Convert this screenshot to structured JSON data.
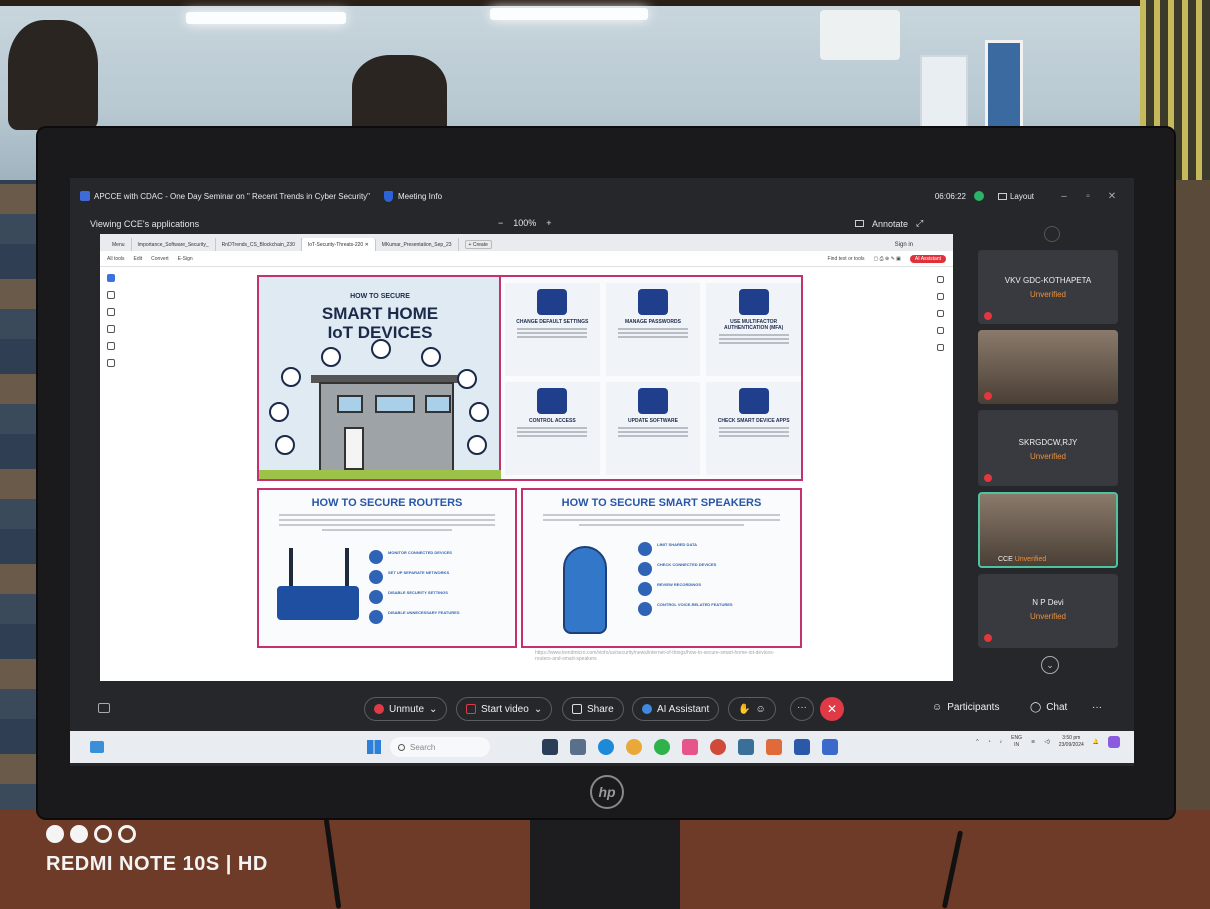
{
  "window": {
    "meeting_title": "APCCE with CDAC - One Day Seminar on \" Recent Trends in Cyber Security\"",
    "meeting_info": "Meeting Info",
    "timer": "06:06:22",
    "layout": "Layout"
  },
  "share_bar": {
    "viewing": "Viewing CCE's applications",
    "zoom_out": "−",
    "zoom": "100%",
    "zoom_in": "+",
    "annotate": "Annotate"
  },
  "browser": {
    "tabs": [
      {
        "label": "Menu"
      },
      {
        "label": "Importance_Software_Security_"
      },
      {
        "label": "RnDTrends_CS_Blockchain_230"
      },
      {
        "label": "IoT-Security-Threats-220"
      },
      {
        "label": "MKumar_Presentation_Sep_23"
      }
    ],
    "new_tab": "+ Create",
    "sign_in": "Sign in",
    "toolbar": {
      "all_tools": "All tools",
      "edit": "Edit",
      "convert": "Convert",
      "esign": "E-Sign",
      "find": "Find text or tools",
      "ai_assistant": "AI Assistant"
    }
  },
  "infographic": {
    "hero_subtitle": "HOW TO SECURE",
    "hero_title_1": "SMART HOME",
    "hero_title_2": "IoT DEVICES",
    "tips": [
      {
        "title": "CHANGE DEFAULT SETTINGS"
      },
      {
        "title": "MANAGE PASSWORDS"
      },
      {
        "title": "USE MULTIFACTOR AUTHENTICATION (MFA)"
      },
      {
        "title": "CONTROL ACCESS"
      },
      {
        "title": "UPDATE SOFTWARE"
      },
      {
        "title": "CHECK SMART DEVICE APPS"
      }
    ],
    "routers_title": "HOW TO SECURE ROUTERS",
    "router_items": [
      "MONITOR CONNECTED DEVICES",
      "SET UP SEPARATE NETWORKS",
      "DISABLE SECURITY SETTINGS",
      "DISABLE UNNECESSARY FEATURES"
    ],
    "speakers_title": "HOW TO SECURE SMART SPEAKERS",
    "speaker_items": [
      "LIMIT SHARED DATA",
      "CHECK CONNECTED DEVICES",
      "REVIEW RECORDINGS",
      "CONTROL VOICE-RELATED FEATURES"
    ],
    "source_url": "https://www.trendmicro.com/vinfo/us/security/news/internet-of-things/how-to-secure-smart-home-iot-devices-routers-and-smart-speakers"
  },
  "participants": [
    {
      "name": "VKV GDC-KOTHAPETA",
      "status": "Unverified"
    },
    {
      "name": "SKRGDCW,RJY",
      "status": "Unverified"
    },
    {
      "name": "CCE",
      "status": "Unverified"
    },
    {
      "name": "N P Devi",
      "status": "Unverified"
    }
  ],
  "controls": {
    "unmute": "Unmute",
    "start_video": "Start video",
    "share": "Share",
    "ai_assistant": "AI Assistant",
    "participants": "Participants",
    "chat": "Chat",
    "more": "···",
    "end": "✕"
  },
  "taskbar": {
    "search_placeholder": "Search",
    "lang": "ENG",
    "lang_region": "IN",
    "time": "3:50 pm",
    "date": "23/09/2024"
  },
  "watermark": {
    "device": "REDMI NOTE 10S | HD"
  },
  "colors": {
    "accent_red": "#e03a46",
    "unverified_orange": "#f0903a",
    "panel_border": "#c3316e",
    "infographic_blue": "#2956a8"
  }
}
